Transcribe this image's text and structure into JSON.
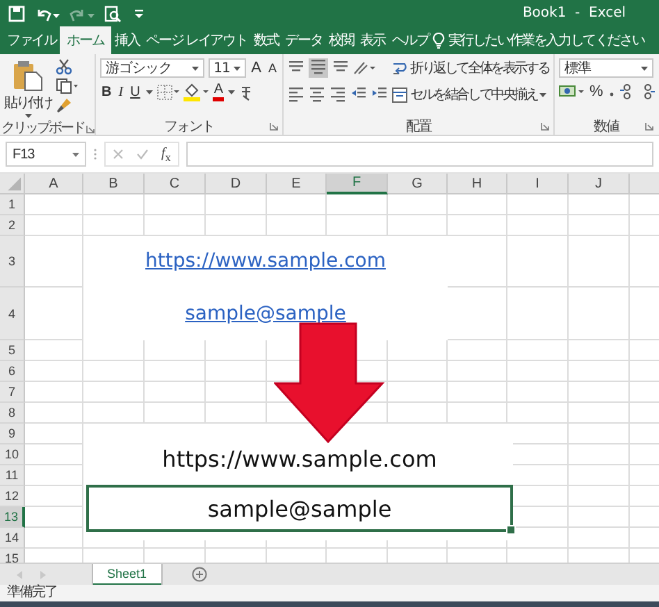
{
  "window": {
    "title": "Book1  -  Excel"
  },
  "quick_access": [
    {
      "kind": "save",
      "disabled": false
    },
    {
      "kind": "undo",
      "disabled": false
    },
    {
      "kind": "redo",
      "disabled": true
    },
    {
      "kind": "preview",
      "disabled": false
    },
    {
      "kind": "customize",
      "disabled": false
    }
  ],
  "tabs": [
    {
      "label": "ファイル",
      "selected": false
    },
    {
      "label": "ホーム",
      "selected": true
    },
    {
      "label": "挿入",
      "selected": false
    },
    {
      "label": "ページ レイアウト",
      "selected": false
    },
    {
      "label": "数式",
      "selected": false
    },
    {
      "label": "データ",
      "selected": false
    },
    {
      "label": "校閲",
      "selected": false
    },
    {
      "label": "表示",
      "selected": false
    },
    {
      "label": "ヘルプ",
      "selected": false
    }
  ],
  "tell_me": {
    "placeholder": "実行したい作業を入力してください"
  },
  "ribbon": {
    "clipboard": {
      "label": "クリップボード",
      "paste": "貼り付け"
    },
    "font": {
      "label": "フォント",
      "name": "游ゴシック",
      "size": "11",
      "grow": "A",
      "shrink": "A",
      "bold": "B",
      "italic": "I",
      "underline": "U",
      "color_letter": "A"
    },
    "alignment": {
      "label": "配置",
      "wrap": "折り返して全体を表示する",
      "merge": "セルを結合して中央揃え"
    },
    "number": {
      "label": "数値",
      "format": "標準",
      "percent": "%"
    }
  },
  "formula_bar": {
    "name_box": "F13",
    "insert_function": "*f*$_{x}$"
  },
  "sheet": {
    "columns": [
      {
        "label": "A",
        "selected": false
      },
      {
        "label": "B",
        "selected": false
      },
      {
        "label": "C",
        "selected": false
      },
      {
        "label": "D",
        "selected": false
      },
      {
        "label": "E",
        "selected": false
      },
      {
        "label": "F",
        "selected": true
      },
      {
        "label": "G",
        "selected": false
      },
      {
        "label": "H",
        "selected": false
      },
      {
        "label": "I",
        "selected": false
      },
      {
        "label": "J",
        "selected": false
      }
    ],
    "rows": [
      {
        "label": "1",
        "selected": false
      },
      {
        "label": "2",
        "selected": false
      },
      {
        "label": "3",
        "selected": false,
        "content": {
          "text": "https://www.sample.com",
          "kind": "link"
        }
      },
      {
        "label": "4",
        "selected": false,
        "content": {
          "text": "sample@sample",
          "kind": "link"
        }
      },
      {
        "label": "5",
        "selected": false
      },
      {
        "label": "6",
        "selected": false
      },
      {
        "label": "7",
        "selected": false
      },
      {
        "label": "8",
        "selected": false
      },
      {
        "label": "9",
        "selected": false
      },
      {
        "label": "10",
        "selected": false
      },
      {
        "label": "11",
        "selected": false
      },
      {
        "label": "12",
        "selected": false
      },
      {
        "label": "13",
        "selected": true
      },
      {
        "label": "14",
        "selected": false
      },
      {
        "label": "15",
        "selected": false
      }
    ]
  },
  "pasted_image": {
    "lines": [
      {
        "text": "https://www.sample.com",
        "boxed": false
      },
      {
        "text": "sample@sample",
        "boxed": true
      }
    ]
  },
  "sheet_tabs": [
    {
      "label": "Sheet1",
      "selected": true
    }
  ],
  "status_bar": {
    "text": "準備完了"
  }
}
